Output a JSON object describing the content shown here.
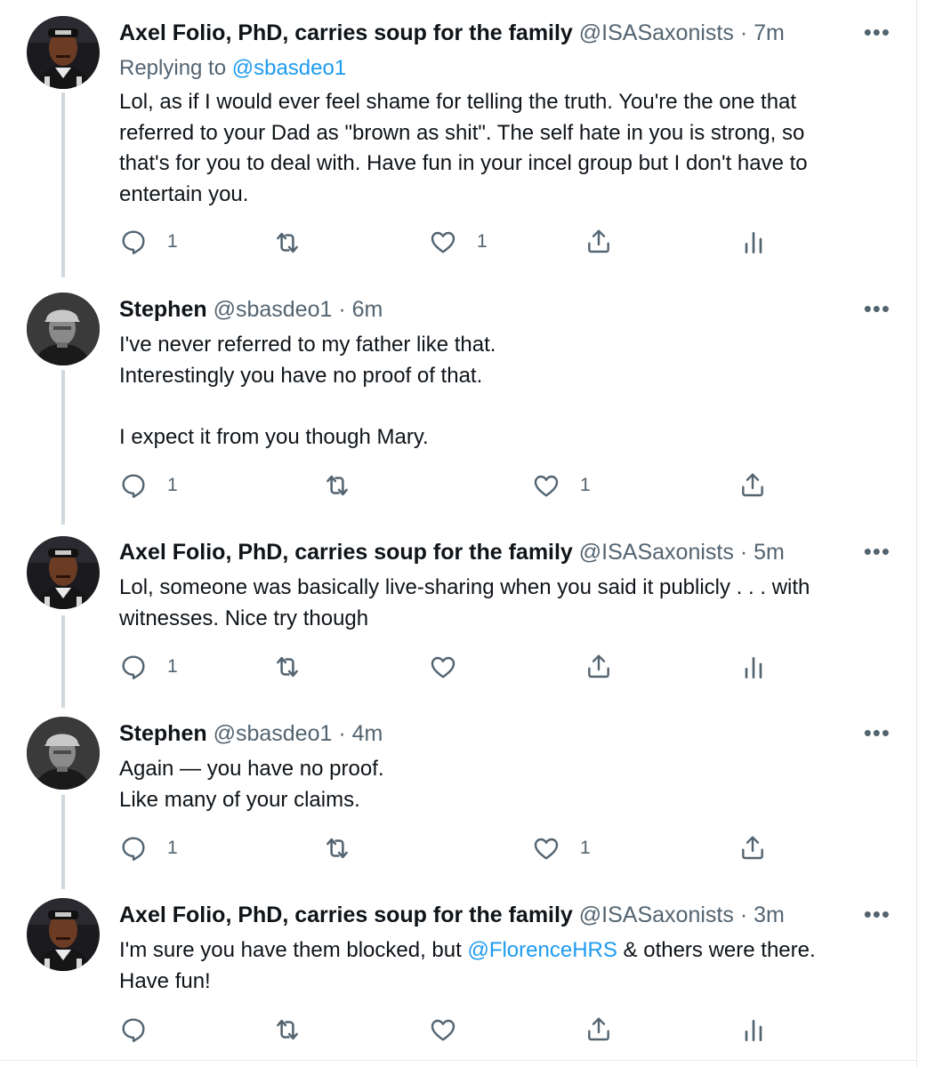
{
  "tweets": [
    {
      "name": "Axel Folio, PhD, carries soup for the family",
      "handle": "@ISASaxonists",
      "separator": "·",
      "time": "7m",
      "more": "•••",
      "replying_prefix": "Replying to",
      "replying_to": "@sbasdeo1",
      "text_lines": [
        "Lol, as if I would ever feel shame for telling the truth. You're the one that",
        "referred to your Dad as \"brown as shit\". The self hate in you is strong, so",
        "that's for you to deal with. Have fun in your incel group but I don't have to",
        "entertain you."
      ],
      "reply_count": "1",
      "retweet_count": "",
      "like_count": "1",
      "icons": [
        "reply-icon",
        "retweet-icon",
        "like-icon",
        "share-icon",
        "analytics-icon"
      ]
    },
    {
      "name": "Stephen",
      "handle": "@sbasdeo1",
      "separator": "·",
      "time": "6m",
      "more": "•••",
      "text_lines": [
        "I've never referred to my father like that.",
        "Interestingly you have no proof of that.",
        "",
        "I expect it from you though Mary."
      ],
      "reply_count": "1",
      "retweet_count": "",
      "like_count": "1",
      "icons": [
        "reply-icon",
        "retweet-icon",
        "like-icon",
        "share-icon"
      ]
    },
    {
      "name": "Axel Folio, PhD, carries soup for the family",
      "handle": "@ISASaxonists",
      "separator": "·",
      "time": "5m",
      "more": "•••",
      "text_lines": [
        "Lol, someone was basically live-sharing when you said it publicly . . . with",
        "witnesses. Nice try though"
      ],
      "reply_count": "1",
      "retweet_count": "",
      "like_count": "",
      "icons": [
        "reply-icon",
        "retweet-icon",
        "like-icon",
        "share-icon",
        "analytics-icon"
      ]
    },
    {
      "name": "Stephen",
      "handle": "@sbasdeo1",
      "separator": "·",
      "time": "4m",
      "more": "•••",
      "text_lines": [
        "Again — you have no proof.",
        "Like many of your claims."
      ],
      "reply_count": "1",
      "retweet_count": "",
      "like_count": "1",
      "icons": [
        "reply-icon",
        "retweet-icon",
        "like-icon",
        "share-icon"
      ]
    },
    {
      "name": "Axel Folio, PhD, carries soup for the family",
      "handle": "@ISASaxonists",
      "separator": "·",
      "time": "3m",
      "more": "•••",
      "text_before": "I'm sure you have them blocked, but ",
      "mention": "@FlorenceHRS",
      "text_after": " & others were there.",
      "text_line2": "Have fun!",
      "reply_count": "",
      "retweet_count": "",
      "like_count": "",
      "icons": [
        "reply-icon",
        "retweet-icon",
        "like-icon",
        "share-icon",
        "analytics-icon"
      ]
    }
  ],
  "colors": {
    "text": "#0f1419",
    "secondary": "#536471",
    "link": "#1d9bf0",
    "thread_line": "#cfd9de",
    "border": "#e1e8ed"
  }
}
